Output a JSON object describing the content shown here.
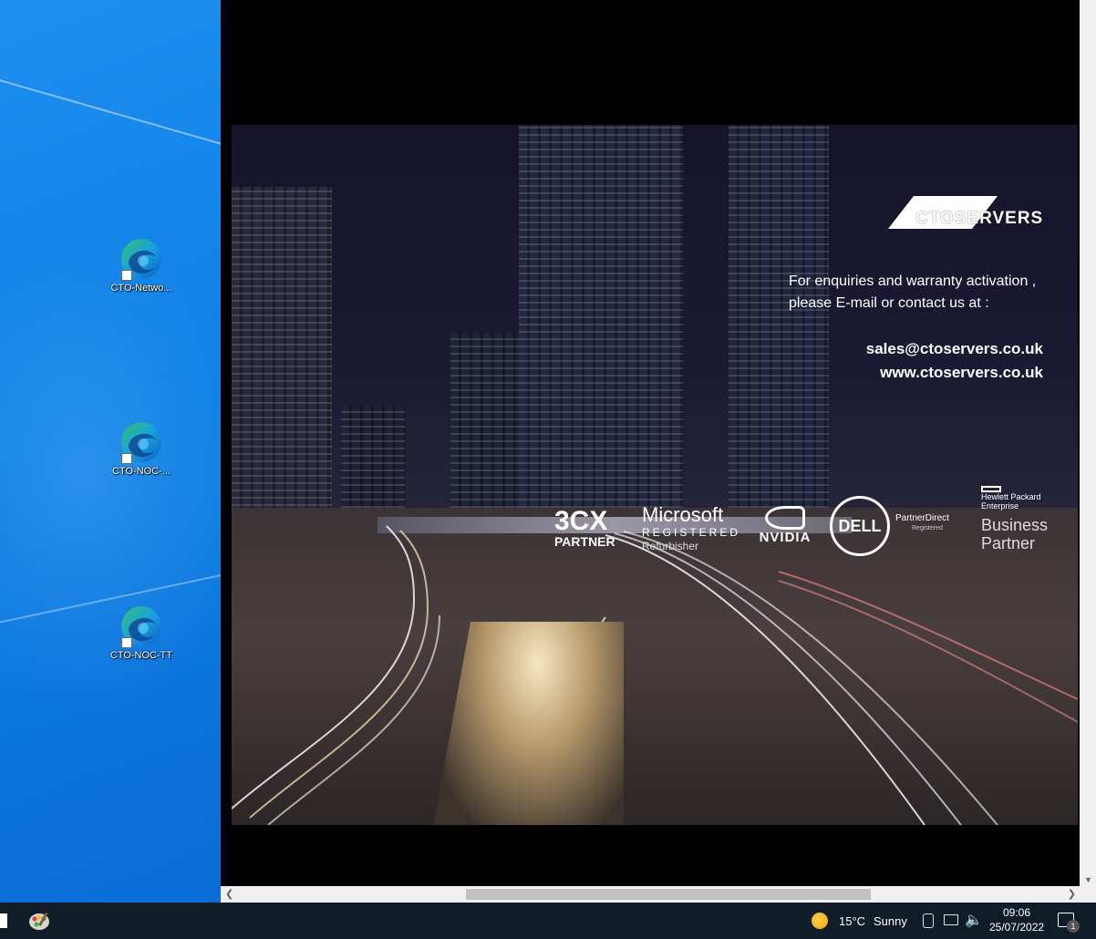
{
  "desktop": {
    "icons": [
      {
        "label": "CTO-Netwo...",
        "icon": "edge-icon"
      },
      {
        "label": "CTO-NOC-...",
        "icon": "edge-icon"
      },
      {
        "label": "CTO-NOC-TT",
        "icon": "edge-icon"
      }
    ]
  },
  "viewer": {
    "brand_logo_text": "CTOSERVERS",
    "enquiry_line1": "For enquiries and warranty activation ,",
    "enquiry_line2": "please E-mail or contact us at :",
    "email": "sales@ctoservers.co.uk",
    "website": "www.ctoservers.co.uk",
    "partners": {
      "threecx_top": "3CX",
      "threecx_bottom": "PARTNER",
      "microsoft_top": "Microsoft",
      "microsoft_mid": "REGISTERED",
      "microsoft_bottom": "Refurbisher",
      "nvidia": "NVIDIA",
      "dell": "DELL",
      "dell_partner": "PartnerDirect",
      "dell_registered": "Registered",
      "hpe_top": "Hewlett Packard",
      "hpe_mid": "Enterprise",
      "hpe_business": "Business",
      "hpe_partner": "Partner"
    }
  },
  "taskbar": {
    "weather_temp": "15°C",
    "weather_text": "Sunny",
    "time": "09:06",
    "date": "25/07/2022",
    "notification_count": "1"
  }
}
